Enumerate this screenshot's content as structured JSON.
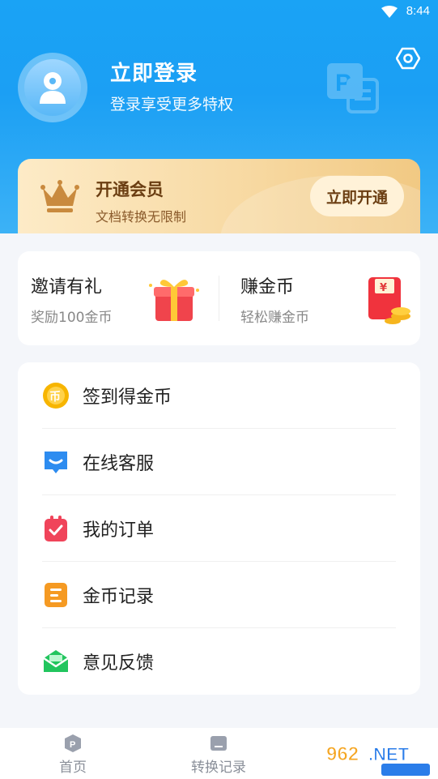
{
  "status_bar": {
    "time": "8:44",
    "icons": [
      "wifi-icon"
    ]
  },
  "profile": {
    "title": "立即登录",
    "subtitle": "登录享受更多特权",
    "avatar_icon": "user-avatar-icon",
    "settings_icon": "settings-icon"
  },
  "vip": {
    "title": "开通会员",
    "subtitle": "文档转换无限制",
    "button_label": "立即开通",
    "icon": "crown-icon"
  },
  "rewards": [
    {
      "title": "邀请有礼",
      "subtitle": "奖励100金币",
      "icon": "gift-icon"
    },
    {
      "title": "赚金币",
      "subtitle": "轻松赚金币",
      "icon": "red-packet-icon"
    }
  ],
  "menu": [
    {
      "label": "签到得金币",
      "icon": "coin-icon",
      "color": "#f7b500"
    },
    {
      "label": "在线客服",
      "icon": "chat-icon",
      "color": "#2d8cf0"
    },
    {
      "label": "我的订单",
      "icon": "clipboard-check-icon",
      "color": "#f0445a"
    },
    {
      "label": "金币记录",
      "icon": "list-icon",
      "color": "#f59a23"
    },
    {
      "label": "意见反馈",
      "icon": "mail-icon",
      "color": "#22c55e"
    }
  ],
  "tabs": [
    {
      "label": "首页",
      "icon": "home-doc-icon"
    },
    {
      "label": "转换记录",
      "icon": "folder-icon"
    }
  ],
  "colors": {
    "header_blue": "#1aa3f5",
    "vip_gold": "#f7d8a0",
    "vip_text": "#6b3e12"
  }
}
